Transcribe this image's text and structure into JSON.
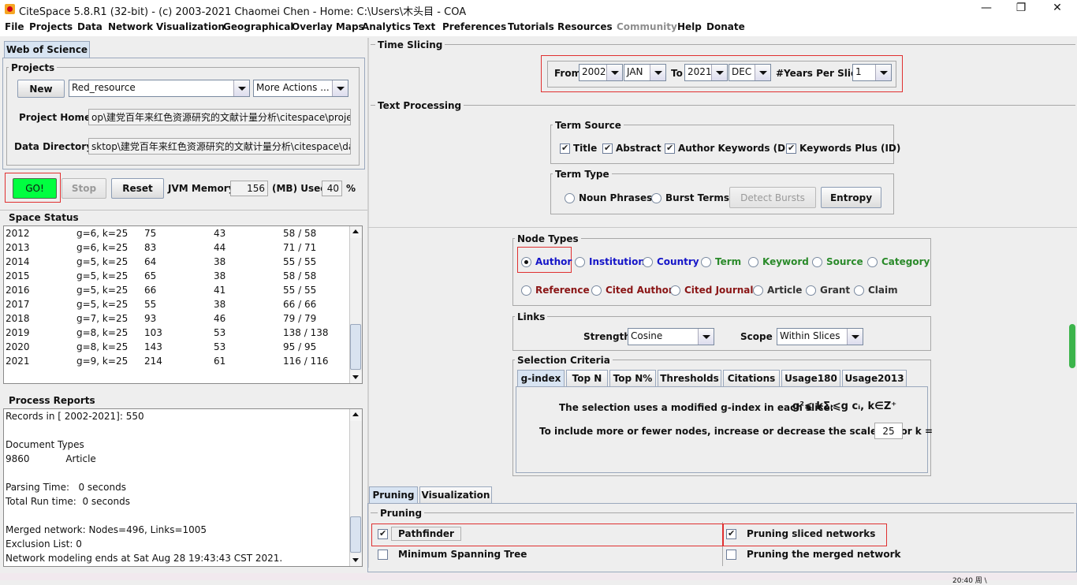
{
  "window": {
    "title": "CiteSpace 5.8.R1 (32-bit) - (c) 2003-2021 Chaomei Chen - Home: C:\\Users\\木头目 - COA",
    "minimize": "—",
    "maximize": "❐",
    "close": "✕"
  },
  "menu": [
    "File",
    "Projects",
    "Data",
    "Network",
    "Visualization",
    "Geographical",
    "Overlay Maps",
    "Analytics",
    "Text",
    "Preferences",
    "Tutorials",
    "Resources",
    "Community",
    "Help",
    "Donate"
  ],
  "left": {
    "tab": "Web of Science",
    "projects": {
      "title": "Projects",
      "new_label": "New",
      "project_select": "Red_resource",
      "more_actions": "More Actions ...",
      "home_label": "Project Home:",
      "home_value": "op\\建党百年来红色资源研究的文献计量分析\\citespace\\project",
      "data_label": "Data Directory:",
      "data_value": "sktop\\建党百年来红色资源研究的文献计量分析\\citespace\\data"
    },
    "controls": {
      "go": "GO!",
      "stop": "Stop",
      "reset": "Reset",
      "jvm_label": "JVM Memory",
      "jvm_value": "156",
      "used_label": "(MB) Used",
      "used_value": "40",
      "pct": "%"
    },
    "space_status": {
      "title": "Space Status",
      "rows": [
        [
          "2012",
          "g=6, k=25",
          "75",
          "43",
          "58 / 58"
        ],
        [
          "2013",
          "g=6, k=25",
          "83",
          "44",
          "71 / 71"
        ],
        [
          "2014",
          "g=5, k=25",
          "64",
          "38",
          "55 / 55"
        ],
        [
          "2015",
          "g=5, k=25",
          "65",
          "38",
          "58 / 58"
        ],
        [
          "2016",
          "g=5, k=25",
          "66",
          "41",
          "55 / 55"
        ],
        [
          "2017",
          "g=5, k=25",
          "55",
          "38",
          "66 / 66"
        ],
        [
          "2018",
          "g=7, k=25",
          "93",
          "46",
          "79 / 79"
        ],
        [
          "2019",
          "g=8, k=25",
          "103",
          "53",
          "138 / 138"
        ],
        [
          "2020",
          "g=8, k=25",
          "143",
          "53",
          "95 / 95"
        ],
        [
          "2021",
          "g=9, k=25",
          "214",
          "61",
          "116 / 116"
        ]
      ]
    },
    "process_reports": {
      "title": "Process Reports",
      "lines": [
        "Records in [ 2002-2021]: 550",
        "",
        "Document Types",
        "9860            Article",
        "",
        "Parsing Time:   0 seconds",
        "Total Run time:  0 seconds",
        "",
        "Merged network: Nodes=496, Links=1005",
        "Exclusion List: 0",
        "Network modeling ends at Sat Aug 28 19:43:43 CST 2021."
      ]
    }
  },
  "time_slicing": {
    "title": "Time Slicing",
    "from_label": "From",
    "from_year": "2002",
    "from_month": "JAN",
    "to_label": "To",
    "to_year": "2021",
    "to_month": "DEC",
    "per_slice_label": "#Years Per Slice",
    "per_slice": "1"
  },
  "text_processing": {
    "title": "Text Processing",
    "term_source": {
      "title": "Term Source",
      "items": [
        "Title",
        "Abstract",
        "Author Keywords (DE)",
        "Keywords Plus (ID)"
      ]
    },
    "term_type": {
      "title": "Term Type",
      "noun": "Noun Phrases",
      "burst": "Burst Terms",
      "detect": "Detect Bursts",
      "entropy": "Entropy"
    }
  },
  "node_types": {
    "title": "Node Types",
    "row1": [
      "Author",
      "Institution",
      "Country",
      "Term",
      "Keyword",
      "Source",
      "Category"
    ],
    "row2": [
      "Reference",
      "Cited Author",
      "Cited Journal",
      "Article",
      "Grant",
      "Claim"
    ]
  },
  "links": {
    "title": "Links",
    "strength_label": "Strength",
    "strength": "Cosine",
    "scope_label": "Scope",
    "scope": "Within Slices"
  },
  "selection": {
    "title": "Selection Criteria",
    "tabs": [
      "g-index",
      "Top N",
      "Top N%",
      "Thresholds",
      "Citations",
      "Usage180",
      "Usage2013"
    ],
    "line1": "The selection uses a modified g-index in each slice:",
    "formula": "g²⩽ kΣᵢ⩽g cᵢ, k∈Z⁺",
    "line2": "To include more or fewer nodes, increase or decrease the scale factor k =",
    "k": "25"
  },
  "bottom": {
    "tabs": [
      "Pruning",
      "Visualization"
    ],
    "pruning_title": "Pruning",
    "pathfinder": "Pathfinder",
    "mst": "Minimum Spanning Tree",
    "sliced": "Pruning sliced networks",
    "merged": "Pruning the merged network"
  },
  "taskbar_time": "20:40 周 \\"
}
